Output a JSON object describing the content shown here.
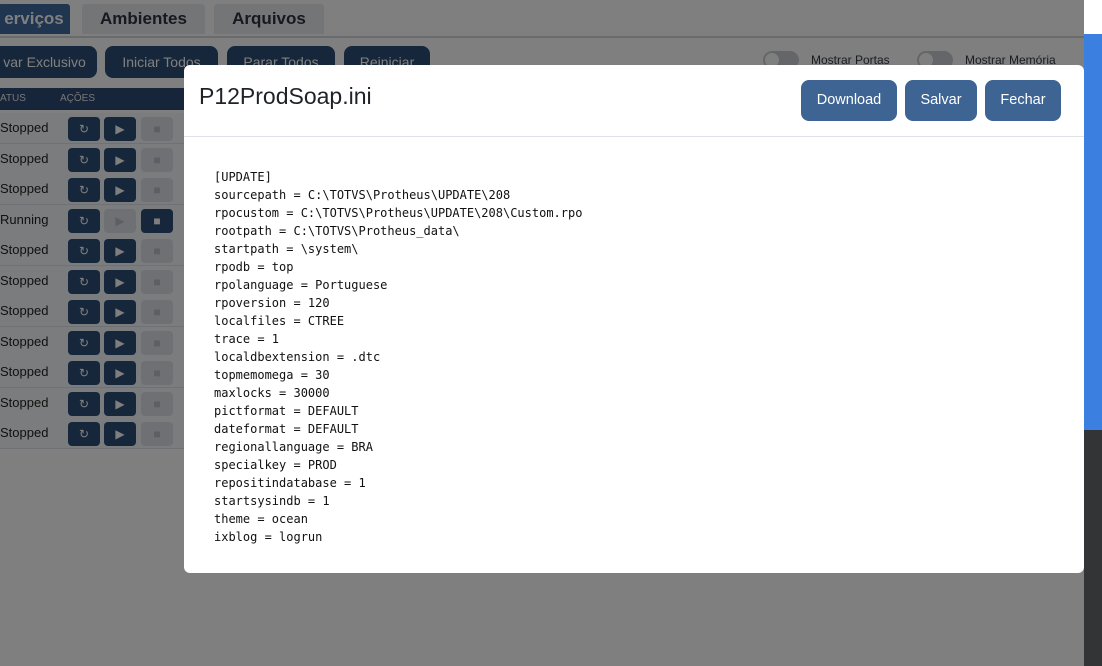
{
  "app": {
    "tabs": [
      {
        "label": "erviços",
        "active": true
      },
      {
        "label": "Ambientes",
        "active": false
      },
      {
        "label": "Arquivos",
        "active": false
      }
    ],
    "toolbar": {
      "exclusive_label": "var Exclusivo",
      "start_all_label": "Iniciar Todos",
      "stop_all_label": "Parar Todos",
      "restart_label": "Reiniciar"
    },
    "toggles": {
      "show_ports_label": "Mostrar Portas",
      "show_memory_label": "Mostrar Memória"
    },
    "table": {
      "headers": {
        "status": "ATUS",
        "actions": "AÇÕES"
      },
      "rows": [
        {
          "status": "Stopped"
        },
        {
          "status": "Stopped"
        },
        {
          "status": "Stopped"
        },
        {
          "status": "Running"
        },
        {
          "status": "Stopped"
        },
        {
          "status": "Stopped"
        },
        {
          "status": "Stopped"
        },
        {
          "status": "Stopped"
        },
        {
          "status": "Stopped"
        },
        {
          "status": "Stopped"
        },
        {
          "status": "Stopped"
        }
      ]
    }
  },
  "modal": {
    "title": "P12ProdSoap.ini",
    "buttons": {
      "download": "Download",
      "save": "Salvar",
      "close": "Fechar"
    },
    "content_lines": [
      "[UPDATE]",
      "sourcepath = C:\\TOTVS\\Protheus\\UPDATE\\208",
      "rpocustom = C:\\TOTVS\\Protheus\\UPDATE\\208\\Custom.rpo",
      "rootpath = C:\\TOTVS\\Protheus_data\\",
      "startpath = \\system\\",
      "rpodb = top",
      "rpolanguage = Portuguese",
      "rpoversion = 120",
      "localfiles = CTREE",
      "trace = 1",
      "localdbextension = .dtc",
      "topmemomega = 30",
      "maxlocks = 30000",
      "pictformat = DEFAULT",
      "dateformat = DEFAULT",
      "regionallanguage = BRA",
      "specialkey = PROD",
      "repositindatabase = 1",
      "startsysindb = 1",
      "theme = ocean",
      "ixblog = logrun"
    ]
  },
  "colors": {
    "primary": "#3d6493",
    "dark_button": "#2e4e76",
    "active_tab": "#3e6aa1",
    "side_accent": "#3b7fe0"
  },
  "icons": {
    "refresh": "refresh-icon",
    "play": "play-icon",
    "stop": "stop-icon"
  }
}
